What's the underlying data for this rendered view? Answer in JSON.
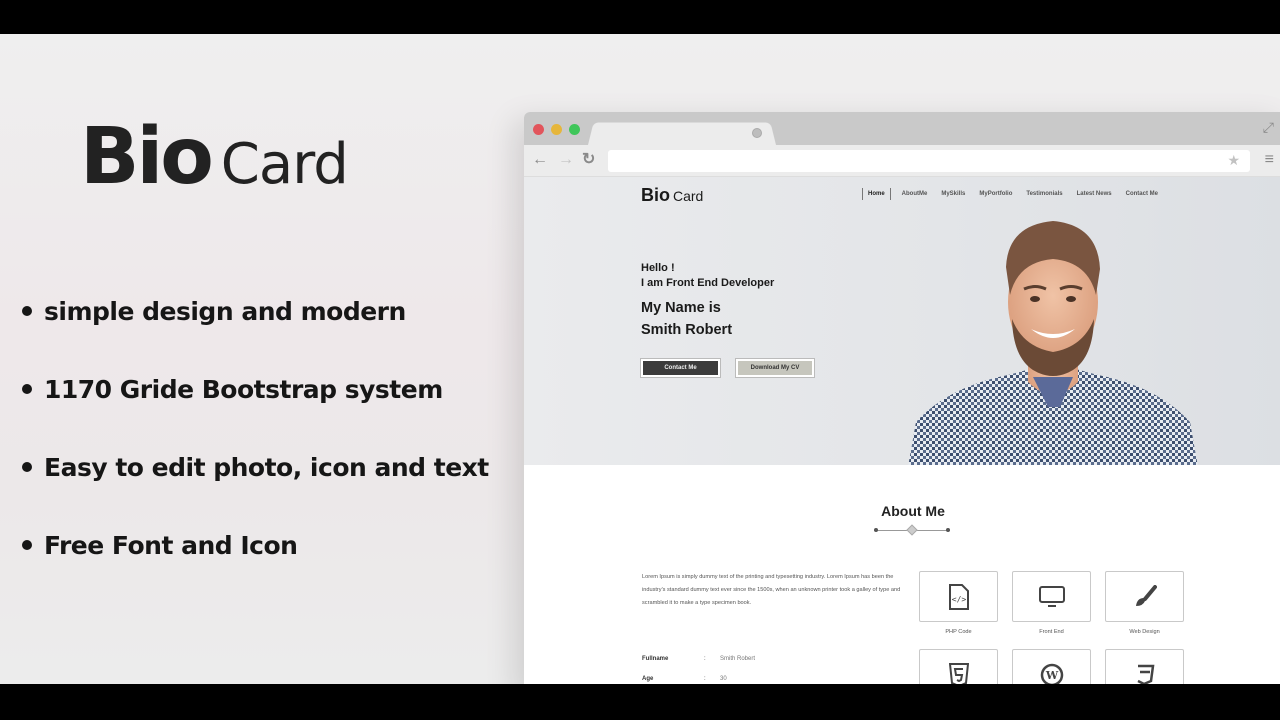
{
  "promo": {
    "title_bold": "Bio",
    "title_light": "Card",
    "features": [
      "simple design and modern",
      "1170 Gride Bootstrap system",
      "Easy to edit photo, icon and text",
      "Free Font and Icon"
    ]
  },
  "browser": {
    "icons": {
      "back": "←",
      "forward": "→",
      "reload": "↻",
      "star": "★",
      "menu": "≡",
      "expand": "⤢"
    },
    "window_controls": [
      "close",
      "minimize",
      "maximize"
    ]
  },
  "site": {
    "logo_bold": "Bio",
    "logo_light": "Card",
    "nav": [
      {
        "label": "Home",
        "active": true
      },
      {
        "label": "AboutMe",
        "active": false
      },
      {
        "label": "MySkills",
        "active": false
      },
      {
        "label": "MyPortfolio",
        "active": false
      },
      {
        "label": "Testimonials",
        "active": false
      },
      {
        "label": "Latest News",
        "active": false
      },
      {
        "label": "Contact Me",
        "active": false
      }
    ],
    "hero": {
      "greeting": "Hello !",
      "role": "I am Front End Developer",
      "name_line1": "My Name is",
      "name_line2": "Smith Robert",
      "primary_button": "Contact Me",
      "secondary_button": "Download My CV"
    },
    "about": {
      "title": "About Me",
      "paragraph": "Lorem Ipsum is simply dummy text of the printing and typesetting industry. Lorem Ipsum has been the industry's standard dummy text ever since the 1500s, when an unknown printer took a galley of type and scrambled it to make a type specimen book.",
      "info": [
        {
          "key": "Fullname",
          "sep": ":",
          "value": "Smith Robert"
        },
        {
          "key": "Age",
          "sep": ":",
          "value": "30"
        }
      ],
      "skills": [
        {
          "label": "PHP Code",
          "icon": "php-file-icon"
        },
        {
          "label": "Front End",
          "icon": "monitor-icon"
        },
        {
          "label": "Web Design",
          "icon": "paintbrush-icon"
        },
        {
          "label": "",
          "icon": "html5-icon"
        },
        {
          "label": "",
          "icon": "wordpress-icon"
        },
        {
          "label": "",
          "icon": "css3-icon"
        }
      ]
    }
  },
  "colors": {
    "dark_text": "#161616",
    "btn_dark": "#3b3b3b",
    "btn_light": "#c6c6bd",
    "traffic_red": "#e2555c",
    "traffic_yellow": "#e6b63b",
    "traffic_green": "#3fc65a"
  }
}
